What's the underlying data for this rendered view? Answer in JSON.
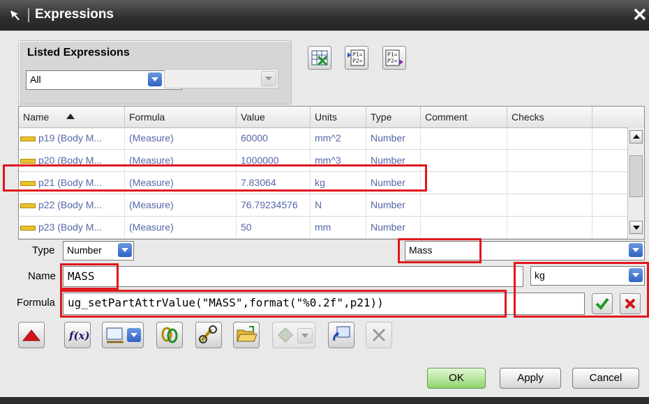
{
  "window": {
    "title": "Expressions",
    "close_glyph": "✕"
  },
  "listed": {
    "title": "Listed Expressions",
    "filter_value": "All",
    "second_filter_value": ""
  },
  "table": {
    "columns": [
      "Name",
      "Formula",
      "Value",
      "Units",
      "Type",
      "Comment",
      "Checks"
    ],
    "sort_column": "Name",
    "rows": [
      {
        "name": "p19  (Body M...",
        "formula": "(Measure)",
        "value": "60000",
        "units": "mm^2",
        "type": "Number",
        "comment": "",
        "checks": ""
      },
      {
        "name": "p20  (Body M...",
        "formula": "(Measure)",
        "value": "1000000",
        "units": "mm^3",
        "type": "Number",
        "comment": "",
        "checks": ""
      },
      {
        "name": "p21  (Body M...",
        "formula": "(Measure)",
        "value": "7.83064",
        "units": "kg",
        "type": "Number",
        "comment": "",
        "checks": ""
      },
      {
        "name": "p22  (Body M...",
        "formula": "(Measure)",
        "value": "76.79234576",
        "units": "N",
        "type": "Number",
        "comment": "",
        "checks": ""
      },
      {
        "name": "p23  (Body M...",
        "formula": "(Measure)",
        "value": "50",
        "units": "mm",
        "type": "Number",
        "comment": "",
        "checks": ""
      }
    ]
  },
  "editor": {
    "type_label": "Type",
    "type_value": "Number",
    "dimension_value": "Mass",
    "name_label": "Name",
    "name_value": "MASS",
    "units_value": "kg",
    "formula_label": "Formula",
    "formula_value": "ug_setPartAttrValue(\"MASS\",format(\"%0.2f\",p21))"
  },
  "buttons": {
    "ok": "OK",
    "apply": "Apply",
    "cancel": "Cancel"
  },
  "colors": {
    "highlight": "#e0171c",
    "cell_text": "#5566a8",
    "ok_green": "#8fd56a"
  }
}
